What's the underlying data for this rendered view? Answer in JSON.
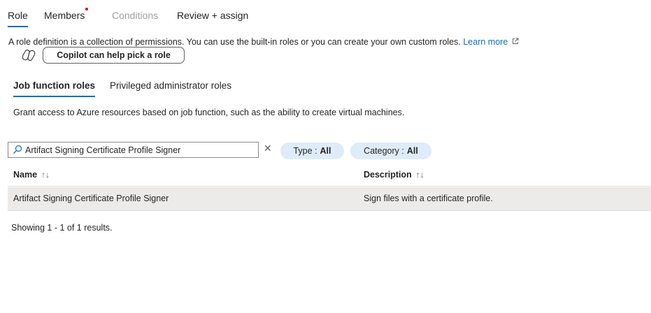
{
  "tabs": [
    {
      "label": "Role",
      "state": "active"
    },
    {
      "label": "Members",
      "state": "notification"
    },
    {
      "label": "Conditions",
      "state": "disabled"
    },
    {
      "label": "Review + assign",
      "state": "normal"
    }
  ],
  "intro": {
    "text": "A role definition is a collection of permissions. You can use the built-in roles or you can create your own custom roles.",
    "learn_more": "Learn more"
  },
  "copilot": {
    "icon": "copilot-icon",
    "label": "Copilot can help pick a role"
  },
  "role_tabs": [
    {
      "label": "Job function roles",
      "active": true
    },
    {
      "label": "Privileged administrator roles",
      "active": false
    }
  ],
  "description": "Grant access to Azure resources based on job function, such as the ability to create virtual machines.",
  "search": {
    "value": "Artifact Signing Certificate Profile Signer",
    "icon": "search-icon"
  },
  "filters": {
    "type": {
      "label": "Type :",
      "value": "All"
    },
    "category": {
      "label": "Category :",
      "value": "All"
    }
  },
  "table": {
    "columns": [
      {
        "label": "Name",
        "sort": "↑↓"
      },
      {
        "label": "Description",
        "sort": "↑↓"
      }
    ],
    "rows": [
      {
        "name": "Artifact Signing Certificate Profile Signer",
        "description": "Sign files with a certificate profile."
      }
    ]
  },
  "results": "Showing 1 - 1 of 1 results.",
  "colors": {
    "accent": "#0f6cbd",
    "notification_dot": "#c50f1f",
    "pill_bg": "#deecf9",
    "row_selected": "#edebe9"
  }
}
